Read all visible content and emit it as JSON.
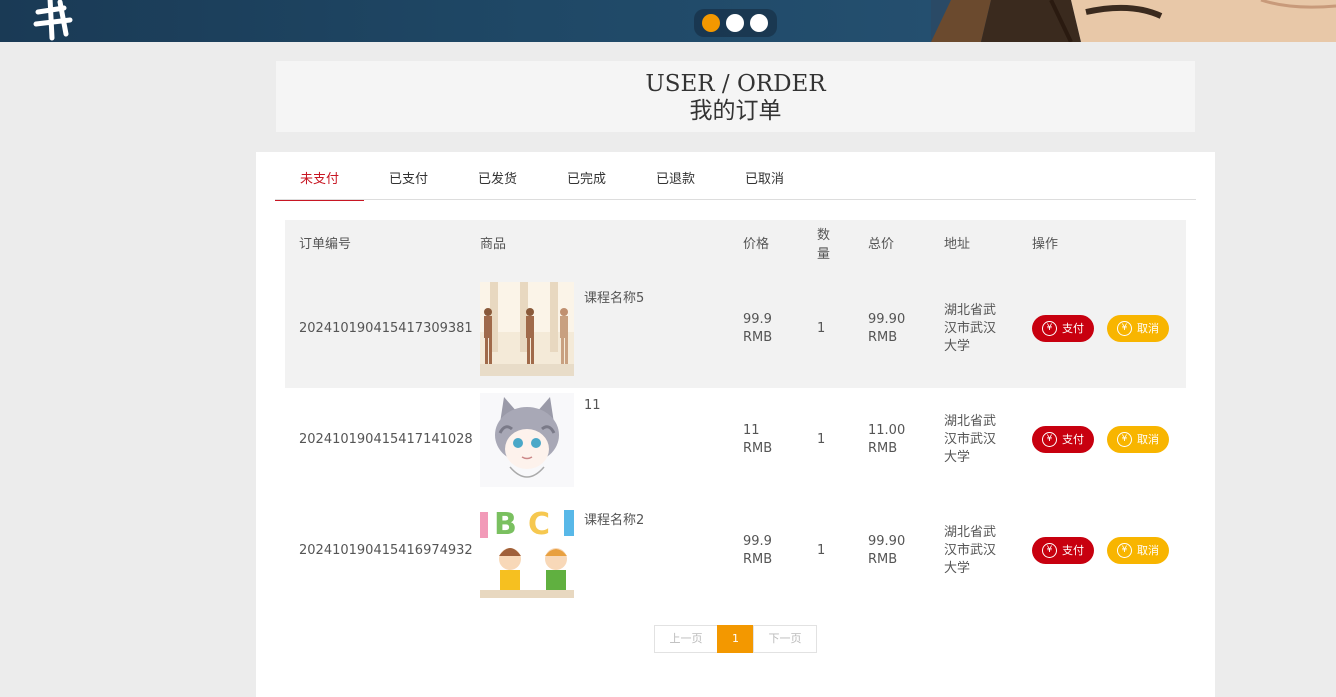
{
  "banner": {
    "carousel_dots": [
      "slide-1",
      "slide-2",
      "slide-3"
    ],
    "active_dot": 0,
    "accent_color": "#f39800"
  },
  "header": {
    "title_en": "USER / ORDER",
    "title_cn": "我的订单"
  },
  "tabs": [
    {
      "label": "未支付",
      "active": true
    },
    {
      "label": "已支付",
      "active": false
    },
    {
      "label": "已发货",
      "active": false
    },
    {
      "label": "已完成",
      "active": false
    },
    {
      "label": "已退款",
      "active": false
    },
    {
      "label": "已取消",
      "active": false
    }
  ],
  "table": {
    "columns": {
      "order_no": "订单编号",
      "product": "商品",
      "price": "价格",
      "qty_1": "数",
      "qty_2": "量",
      "total": "总价",
      "address": "地址",
      "action": "操作"
    },
    "rows": [
      {
        "order_no": "20241019041541730938​1",
        "product_name": "课程名称5",
        "thumb": "yoga-class-image",
        "price_1": "99.9",
        "price_2": "RMB",
        "qty": "1",
        "total_1": "99.90",
        "total_2": "RMB",
        "addr_1": "湖北省武",
        "addr_2": "汉市武汉",
        "addr_3": "大学",
        "pay_label": "支付",
        "cancel_label": "取消"
      },
      {
        "order_no": "20241019041541714102​8",
        "product_name": "11",
        "thumb": "anime-cat-boy-image",
        "price_1": "11",
        "price_2": "RMB",
        "qty": "1",
        "total_1": "11.00",
        "total_2": "RMB",
        "addr_1": "湖北省武",
        "addr_2": "汉市武汉",
        "addr_3": "大学",
        "pay_label": "支付",
        "cancel_label": "取消"
      },
      {
        "order_no": "20241019041541697493​2",
        "product_name": "课程名称2",
        "thumb": "abc-kids-image",
        "price_1": "99.9",
        "price_2": "RMB",
        "qty": "1",
        "total_1": "99.90",
        "total_2": "RMB",
        "addr_1": "湖北省武",
        "addr_2": "汉市武汉",
        "addr_3": "大学",
        "pay_label": "支付",
        "cancel_label": "取消"
      }
    ]
  },
  "pagination": {
    "prev": "上一页",
    "current": "1",
    "next": "下一页"
  },
  "icons": {
    "currency": "yen-icon"
  },
  "colors": {
    "pay": "#c8000f",
    "cancel": "#f8b500",
    "active_tab": "#c81623"
  }
}
